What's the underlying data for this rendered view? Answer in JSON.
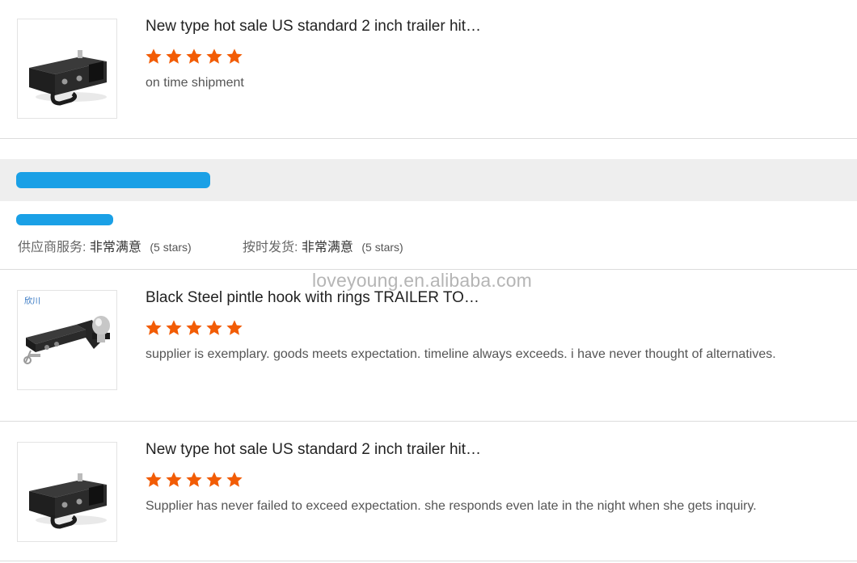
{
  "colors": {
    "star": "#f25c05",
    "redaction": "#1aa0e6",
    "band": "#eeeeee"
  },
  "reviews": [
    {
      "title": "New type hot sale US standard 2 inch trailer hit…",
      "stars": 5,
      "comment": "on time shipment",
      "thumb_icon": "trailer-hitch-receiver-icon"
    },
    {
      "title": "Black Steel pintle hook with rings TRAILER TO…",
      "stars": 5,
      "comment": "supplier is exemplary. goods meets expectation. timeline always exceeds. i have never thought of alternatives.",
      "thumb_icon": "ball-mount-hitch-icon",
      "thumb_brand": "欣川"
    },
    {
      "title": "New type hot sale US standard 2 inch trailer hit…",
      "stars": 5,
      "comment": "Supplier has never failed to exceed expectation. she responds even late in the night when she gets inquiry.",
      "thumb_icon": "trailer-hitch-receiver-icon"
    }
  ],
  "supplier_rating": {
    "service_label": "供应商服务:",
    "service_value": "非常满意",
    "service_count": "(5 stars)",
    "shipping_label": "按时发货:",
    "shipping_value": "非常满意",
    "shipping_count": "(5 stars)"
  },
  "watermark": "loveyoung.en.alibaba.com"
}
